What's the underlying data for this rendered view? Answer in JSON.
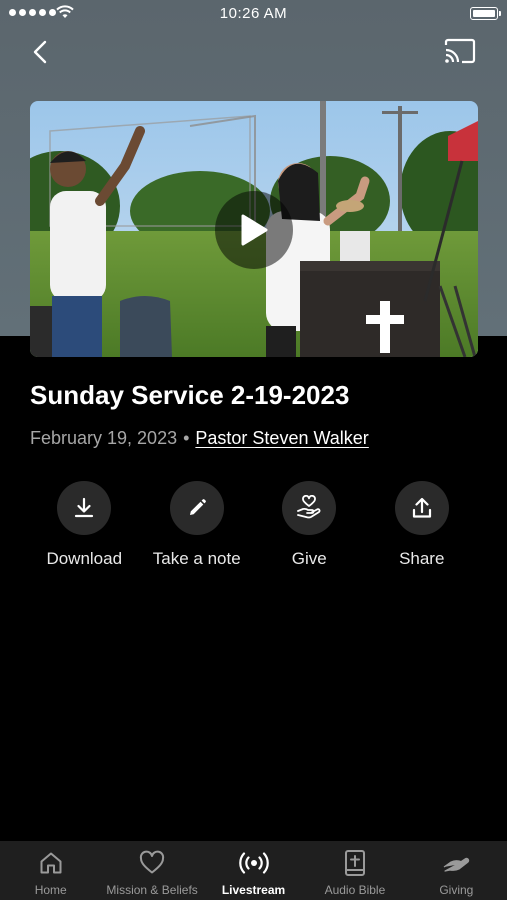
{
  "status_bar": {
    "time": "10:26 AM"
  },
  "video": {
    "play_label": "Play"
  },
  "sermon": {
    "title": "Sunday Service 2-19-2023",
    "date": "February 19, 2023",
    "separator": "•",
    "speaker": "Pastor Steven Walker"
  },
  "actions": [
    {
      "label": "Download",
      "icon": "download-icon"
    },
    {
      "label": "Take a note",
      "icon": "pencil-icon"
    },
    {
      "label": "Give",
      "icon": "give-hand-heart-icon"
    },
    {
      "label": "Share",
      "icon": "share-icon"
    }
  ],
  "tab_bar": {
    "active": "Livestream",
    "tabs": [
      {
        "label": "Home",
        "icon": "home-icon"
      },
      {
        "label": "Mission & Beliefs",
        "icon": "heart-icon"
      },
      {
        "label": "Livestream",
        "icon": "broadcast-icon"
      },
      {
        "label": "Audio Bible",
        "icon": "bible-icon"
      },
      {
        "label": "Giving",
        "icon": "giving-hand-icon"
      }
    ]
  },
  "colors": {
    "header_bg": "#5b666d",
    "page_bg": "#000000",
    "tab_bar_bg": "#1f1f1f",
    "action_circle": "#2a2a2a",
    "muted_text": "#a6a6a6"
  }
}
